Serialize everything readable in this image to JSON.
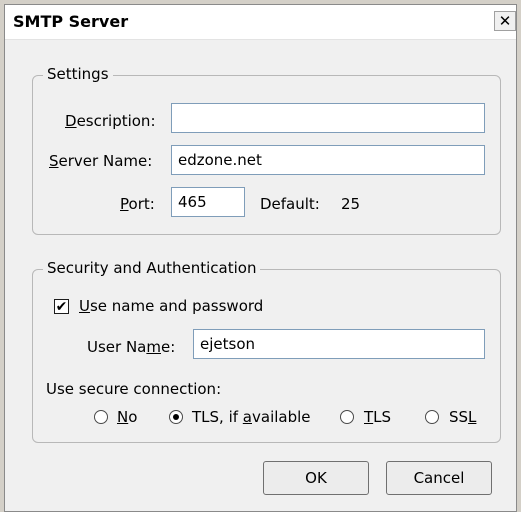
{
  "window": {
    "title": "SMTP Server",
    "close_glyph": "✕"
  },
  "settings": {
    "legend": "Settings",
    "description_label_u": "D",
    "description_label_rest": "escription:",
    "description_value": "",
    "server_label_u": "S",
    "server_label_rest": "erver Name:",
    "server_value": "edzone.net",
    "port_label_u": "P",
    "port_label_rest": "ort:",
    "port_value": "465",
    "default_label": "Default:",
    "default_value": "25"
  },
  "security": {
    "legend": "Security and Authentication",
    "use_name_label_u": "U",
    "use_name_label_rest": "se name and password",
    "use_name_checked": true,
    "username_label_pre": "User Na",
    "username_label_u": "m",
    "username_label_post": "e:",
    "username_value": "ejetson",
    "secure_label": "Use secure connection:",
    "radio_no_u": "N",
    "radio_no_rest": "o",
    "radio_tls_avail_pre": "TLS, if ",
    "radio_tls_avail_u": "a",
    "radio_tls_avail_post": "vailable",
    "radio_tls_u": "T",
    "radio_tls_rest": "LS",
    "radio_ssl_pre": "SS",
    "radio_ssl_u": "L",
    "selected": "tls_if_available"
  },
  "buttons": {
    "ok": "OK",
    "cancel": "Cancel"
  }
}
